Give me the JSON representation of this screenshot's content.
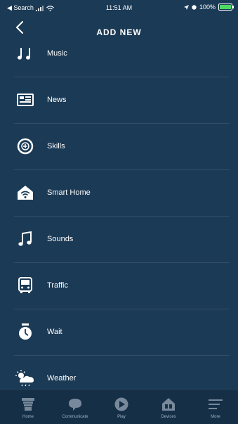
{
  "status_bar": {
    "carrier": "◀ Search",
    "time": "11:51 AM",
    "battery": "100%"
  },
  "header": {
    "title": "ADD NEW"
  },
  "items": [
    {
      "label": "Music",
      "icon": "music-notes-icon"
    },
    {
      "label": "News",
      "icon": "newspaper-icon"
    },
    {
      "label": "Skills",
      "icon": "skills-icon"
    },
    {
      "label": "Smart Home",
      "icon": "smart-home-icon"
    },
    {
      "label": "Sounds",
      "icon": "music-note-icon"
    },
    {
      "label": "Traffic",
      "icon": "bus-icon"
    },
    {
      "label": "Wait",
      "icon": "timer-icon"
    },
    {
      "label": "Weather",
      "icon": "weather-icon"
    }
  ],
  "tabs": [
    {
      "label": "Home",
      "icon": "home-icon"
    },
    {
      "label": "Communicate",
      "icon": "chat-icon"
    },
    {
      "label": "Play",
      "icon": "play-icon"
    },
    {
      "label": "Devices",
      "icon": "devices-icon"
    },
    {
      "label": "More",
      "icon": "menu-icon"
    }
  ]
}
